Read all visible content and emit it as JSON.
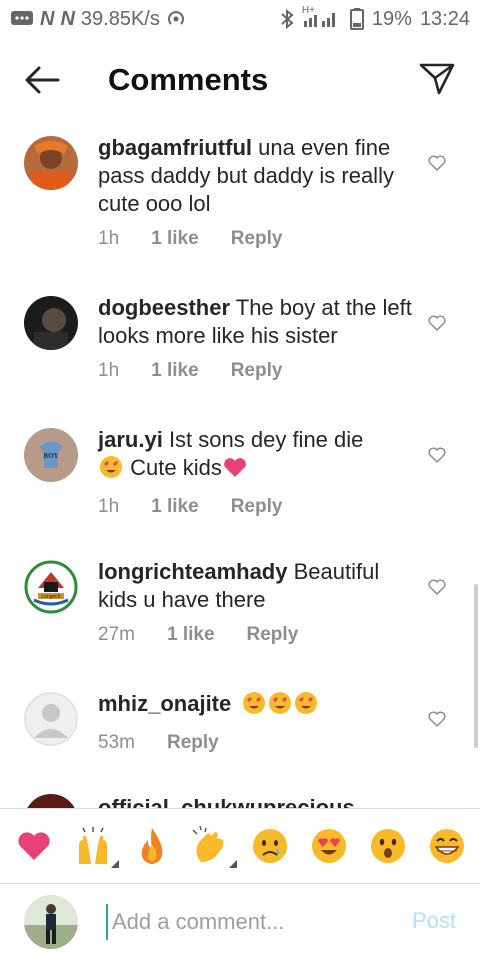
{
  "status_bar": {
    "network_speed": "39.85K/s",
    "carrier_marks": [
      "N",
      "N"
    ],
    "signal_label": "H+",
    "battery": "19%",
    "time": "13:24"
  },
  "header": {
    "title": "Comments"
  },
  "comments": [
    {
      "username": "gbagamfriutful",
      "text": "una even fine pass daddy but daddy is really cute ooo lol",
      "time": "1h",
      "likes": "1 like",
      "reply": "Reply"
    },
    {
      "username": "dogbeesther",
      "text": "The boy at the left looks more like his sister",
      "time": "1h",
      "likes": "1 like",
      "reply": "Reply"
    },
    {
      "username": "jaru.yi",
      "text": "Ist sons dey fine die",
      "text2": "Cute kids",
      "time": "1h",
      "likes": "1 like",
      "reply": "Reply"
    },
    {
      "username": "longrichteamhady",
      "text": "Beautiful kids u have there",
      "time": "27m",
      "likes": "1 like",
      "reply": "Reply"
    },
    {
      "username": "mhiz_onajite",
      "text": "",
      "time": "53m",
      "reply": "Reply"
    },
    {
      "username": "official_chukwuprecious",
      "text": ""
    }
  ],
  "emoji_bar": [
    "heart",
    "raised-hands",
    "fire",
    "clapping-hands",
    "sad-face",
    "heart-eyes",
    "surprised-face",
    "grinning-face"
  ],
  "composer": {
    "placeholder": "Add a comment...",
    "post_label": "Post"
  },
  "colors": {
    "accent_post": "#b2dffc",
    "heart": "#ed4956",
    "cursor": "#26a69a"
  }
}
